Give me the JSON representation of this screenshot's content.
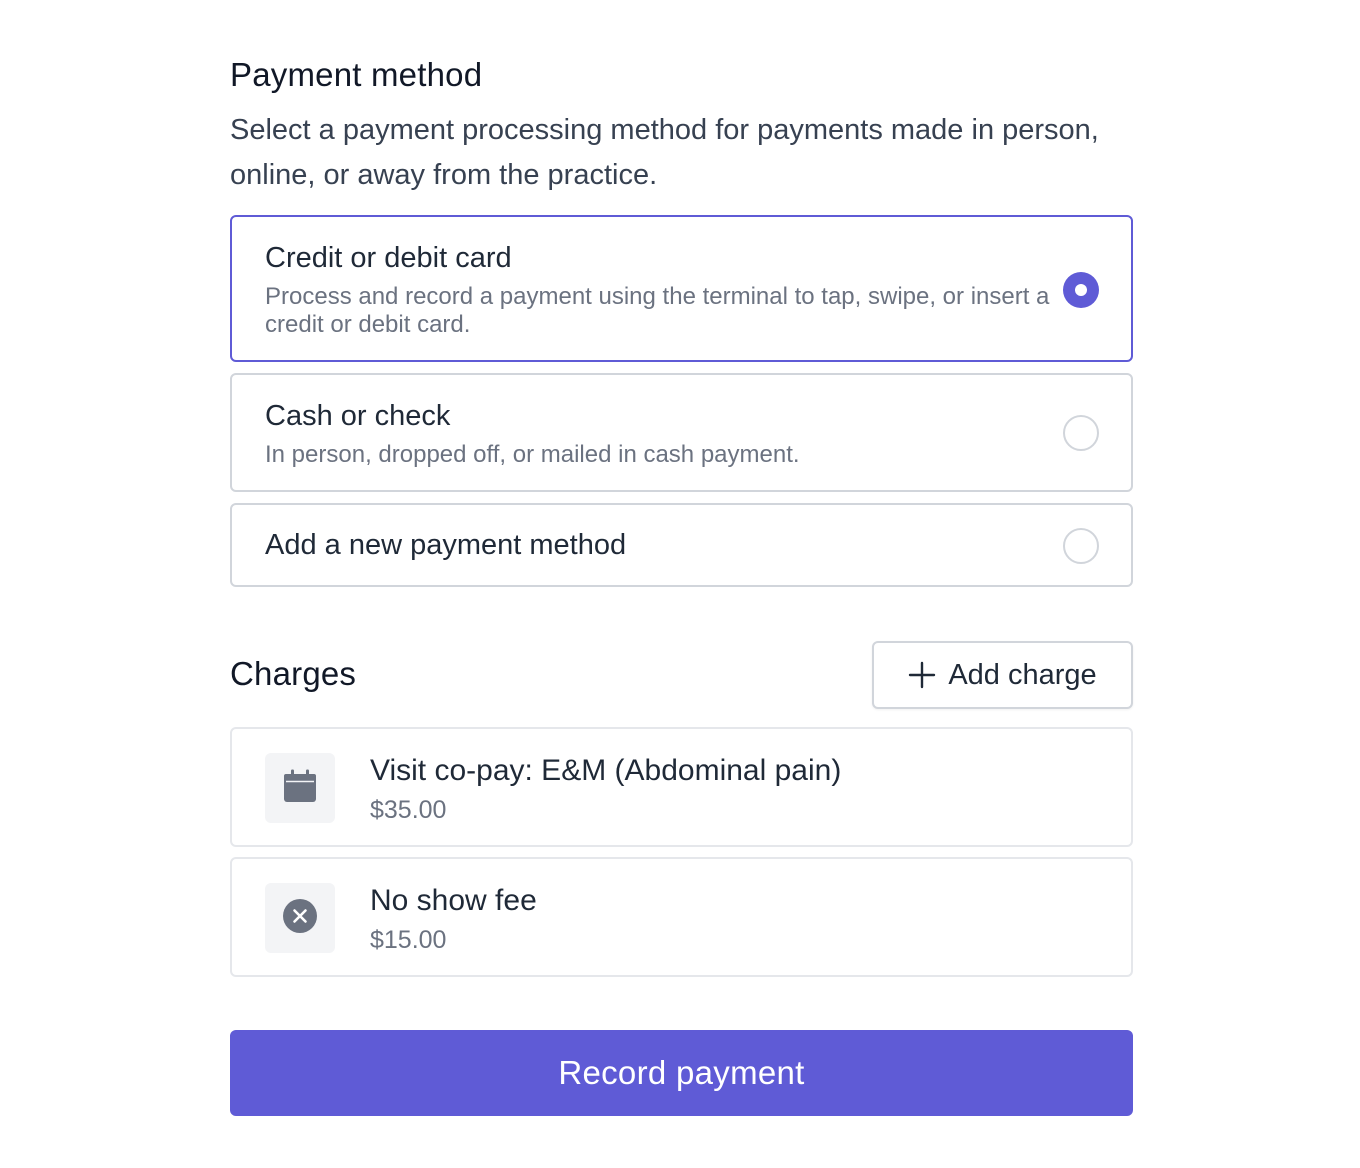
{
  "payment_method": {
    "title": "Payment method",
    "description": "Select a payment processing method for payments made in person, online, or away from the practice.",
    "options": [
      {
        "label": "Credit or debit card",
        "description": "Process and record a payment using the terminal to tap, swipe, or insert a credit or debit card.",
        "selected": true
      },
      {
        "label": "Cash or check",
        "description": "In person, dropped off, or mailed in cash payment.",
        "selected": false
      },
      {
        "label": "Add a new payment method",
        "selected": false
      }
    ]
  },
  "charges": {
    "title": "Charges",
    "add_label": "Add charge",
    "items": [
      {
        "name": "Visit co-pay: E&M (Abdominal pain)",
        "amount": "$35.00",
        "icon": "calendar-icon"
      },
      {
        "name": "No show fee",
        "amount": "$15.00",
        "icon": "x-circle-icon"
      }
    ]
  },
  "actions": {
    "record_label": "Record payment"
  },
  "colors": {
    "accent": "#5f5bd6",
    "border": "#d1d5db",
    "muted_text": "#6b7280",
    "icon_fill": "#6b7280",
    "icon_bg": "#f3f4f6"
  }
}
